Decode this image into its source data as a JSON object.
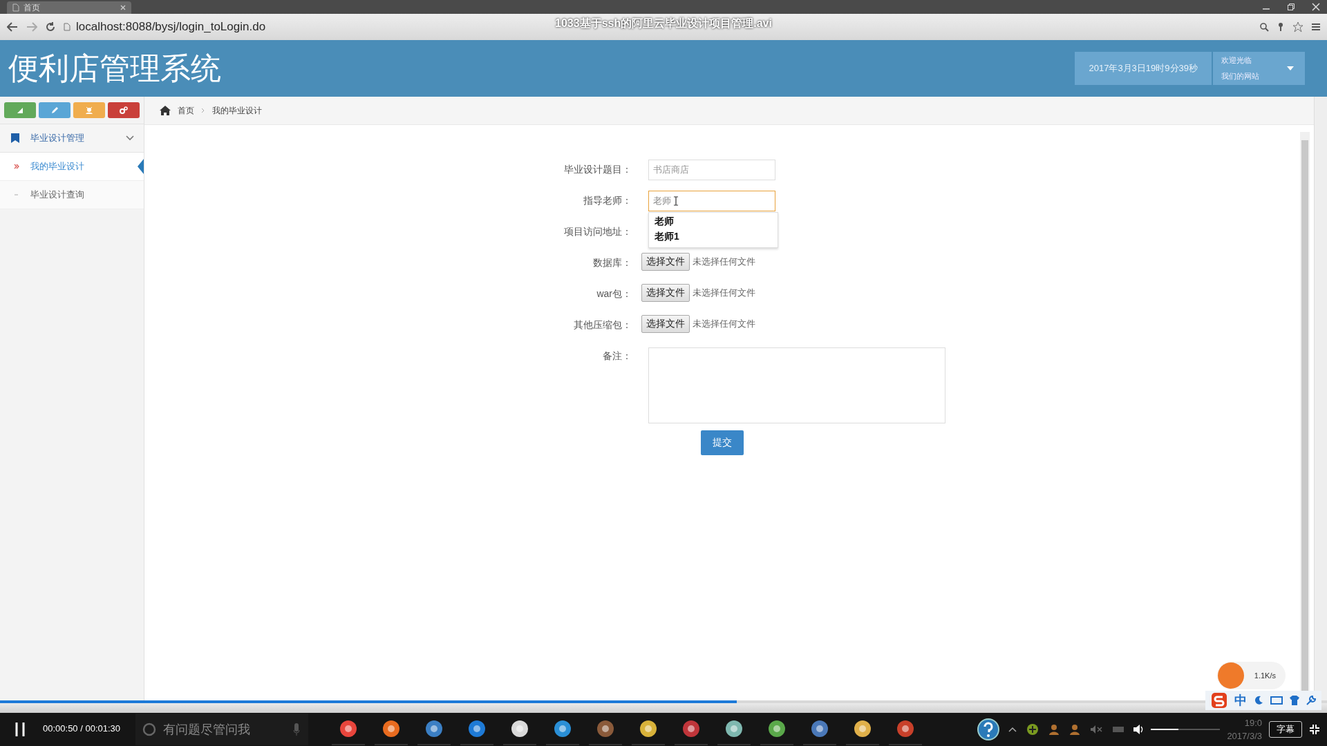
{
  "video_title": "1033基于ssh的阿里云毕业设计项目管理.avi",
  "browser": {
    "tab": "首页",
    "url": "localhost:8088/bysj/login_toLogin.do"
  },
  "header": {
    "title": "便利店管理系统",
    "datetime": "2017年3月3日19时9分39秒",
    "user_lines": [
      "欢迎光临",
      "我们的网站"
    ]
  },
  "shortcuts": [
    {
      "kind": "chart",
      "color": "#62a95a"
    },
    {
      "kind": "pencil",
      "color": "#5aa6d6"
    },
    {
      "kind": "users",
      "color": "#f0ad4e"
    },
    {
      "kind": "cogs",
      "color": "#c9403a"
    }
  ],
  "sidebar": {
    "menus": [
      {
        "label": "毕业设计管理",
        "expanded": true,
        "children": [
          {
            "label": "我的毕业设计",
            "selected": true
          },
          {
            "label": "毕业设计查询",
            "selected": false
          }
        ]
      }
    ]
  },
  "breadcrumb": [
    "首页",
    "我的毕业设计"
  ],
  "form": {
    "fields": [
      {
        "kind": "text",
        "label": "毕业设计题目：",
        "value": "书店商店",
        "focused": false
      },
      {
        "kind": "text",
        "label": "指导老师：",
        "value": "老师",
        "focused": true,
        "suggestions": [
          "老师",
          "老师1"
        ]
      },
      {
        "kind": "covered",
        "label": "项目访问地址："
      },
      {
        "kind": "file",
        "label": "数据库：",
        "button": "选择文件",
        "status": "未选择任何文件"
      },
      {
        "kind": "file",
        "label": "war包：",
        "button": "选择文件",
        "status": "未选择任何文件"
      },
      {
        "kind": "file",
        "label": "其他压缩包：",
        "button": "选择文件",
        "status": "未选择任何文件"
      },
      {
        "kind": "textarea",
        "label": "备注："
      }
    ],
    "submit": "提交"
  },
  "player": {
    "time": "00:00:50 / 00:01:30",
    "progress": {
      "level": 0.555
    },
    "volume": {
      "level": 0.4
    },
    "subtitle_button": "字幕"
  },
  "taskbar": {
    "search_placeholder": "有问题尽管问我",
    "apps": [
      {
        "color": "#e8453c"
      },
      {
        "color": "#e86b1f"
      },
      {
        "color": "#3b7fc4"
      },
      {
        "color": "#1e7ad6"
      },
      {
        "color": "#d9d9d9"
      },
      {
        "color": "#2a8fd6"
      },
      {
        "color": "#8a5a3a"
      },
      {
        "color": "#d8b23a"
      },
      {
        "color": "#c0353a"
      },
      {
        "color": "#7fb8b0"
      },
      {
        "color": "#5aa84a"
      },
      {
        "color": "#4a78b8"
      },
      {
        "color": "#e0b04a"
      },
      {
        "color": "#c8402a"
      }
    ],
    "net_speed": "1.1K/s",
    "ime": "中",
    "clock_time": "19:0",
    "clock_date": "2017/3/3"
  }
}
